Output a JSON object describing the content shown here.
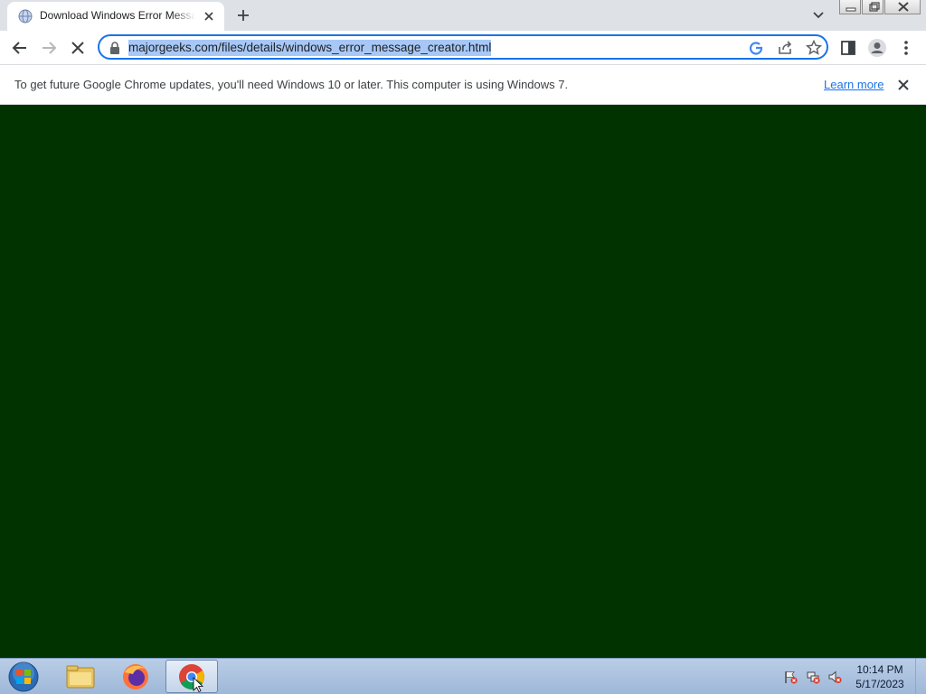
{
  "browser": {
    "tab": {
      "title": "Download Windows Error Message Creator"
    },
    "address_bar": {
      "url": "majorgeeks.com/files/details/windows_error_message_creator.html"
    }
  },
  "infobar": {
    "message": "To get future Google Chrome updates, you'll need Windows 10 or later. This computer is using Windows 7.",
    "link_label": "Learn more"
  },
  "page": {
    "background_color": "#003300"
  },
  "taskbar": {
    "apps": [
      "Windows Explorer",
      "Firefox",
      "Google Chrome"
    ],
    "clock": {
      "time": "10:14 PM",
      "date": "5/17/2023"
    }
  },
  "colors": {
    "accent": "#1a73e8",
    "url_selection": "#a7c8f7",
    "taskbar": "#b9cde6"
  }
}
